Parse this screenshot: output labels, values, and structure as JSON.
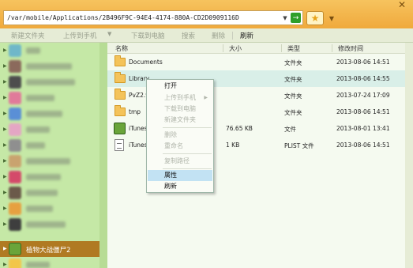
{
  "path_bar": {
    "value": "/var/mobile/Applications/2B496F9C-94E4-4174-880A-CD2D0909116D"
  },
  "toolbar": {
    "new_folder": "新建文件夹",
    "upload_to_phone": "上传到手机",
    "download_to_pc": "下载到电脑",
    "delete": "删除",
    "refresh": "刷新",
    "search": "搜索"
  },
  "sidebar": {
    "selected_item": "植物大战僵尸2"
  },
  "columns": {
    "name": "名称",
    "size": "大小",
    "type": "类型",
    "modified": "修改时间"
  },
  "files": [
    {
      "name": "Documents",
      "size": "",
      "type": "文件夹",
      "modified": "2013-08-06 14:51",
      "icon": "folder-icon"
    },
    {
      "name": "Library",
      "size": "",
      "type": "文件夹",
      "modified": "2013-08-06 14:55",
      "icon": "folder-icon"
    },
    {
      "name": "PvZ2.w",
      "size": "",
      "type": "文件夹",
      "modified": "2013-07-24 17:09",
      "icon": "folder-icon"
    },
    {
      "name": "tmp",
      "size": "",
      "type": "文件夹",
      "modified": "2013-08-06 14:51",
      "icon": "folder-icon"
    },
    {
      "name": "iTunes",
      "size": "76.65 KB",
      "type": "文件",
      "modified": "2013-08-01 13:41",
      "icon": "app-icon"
    },
    {
      "name": "iTunes",
      "size": "1 KB",
      "type": "PLIST 文件",
      "modified": "2013-08-06 14:51",
      "icon": "plist-file-icon"
    }
  ],
  "context_menu": {
    "open": "打开",
    "upload_to_phone": "上传到手机",
    "download_to_pc": "下载到电脑",
    "new_folder": "新建文件夹",
    "delete": "删除",
    "rename": "重命名",
    "copy_path": "复制路径",
    "properties": "属性",
    "refresh": "刷新"
  },
  "colors": {
    "window_frame": "#f5b24a",
    "sidebar_bg": "#c5e8a6",
    "sidebar_selected": "#b07a22",
    "row_highlight": "#d9efe8",
    "menu_highlight": "#c2e2f3"
  }
}
